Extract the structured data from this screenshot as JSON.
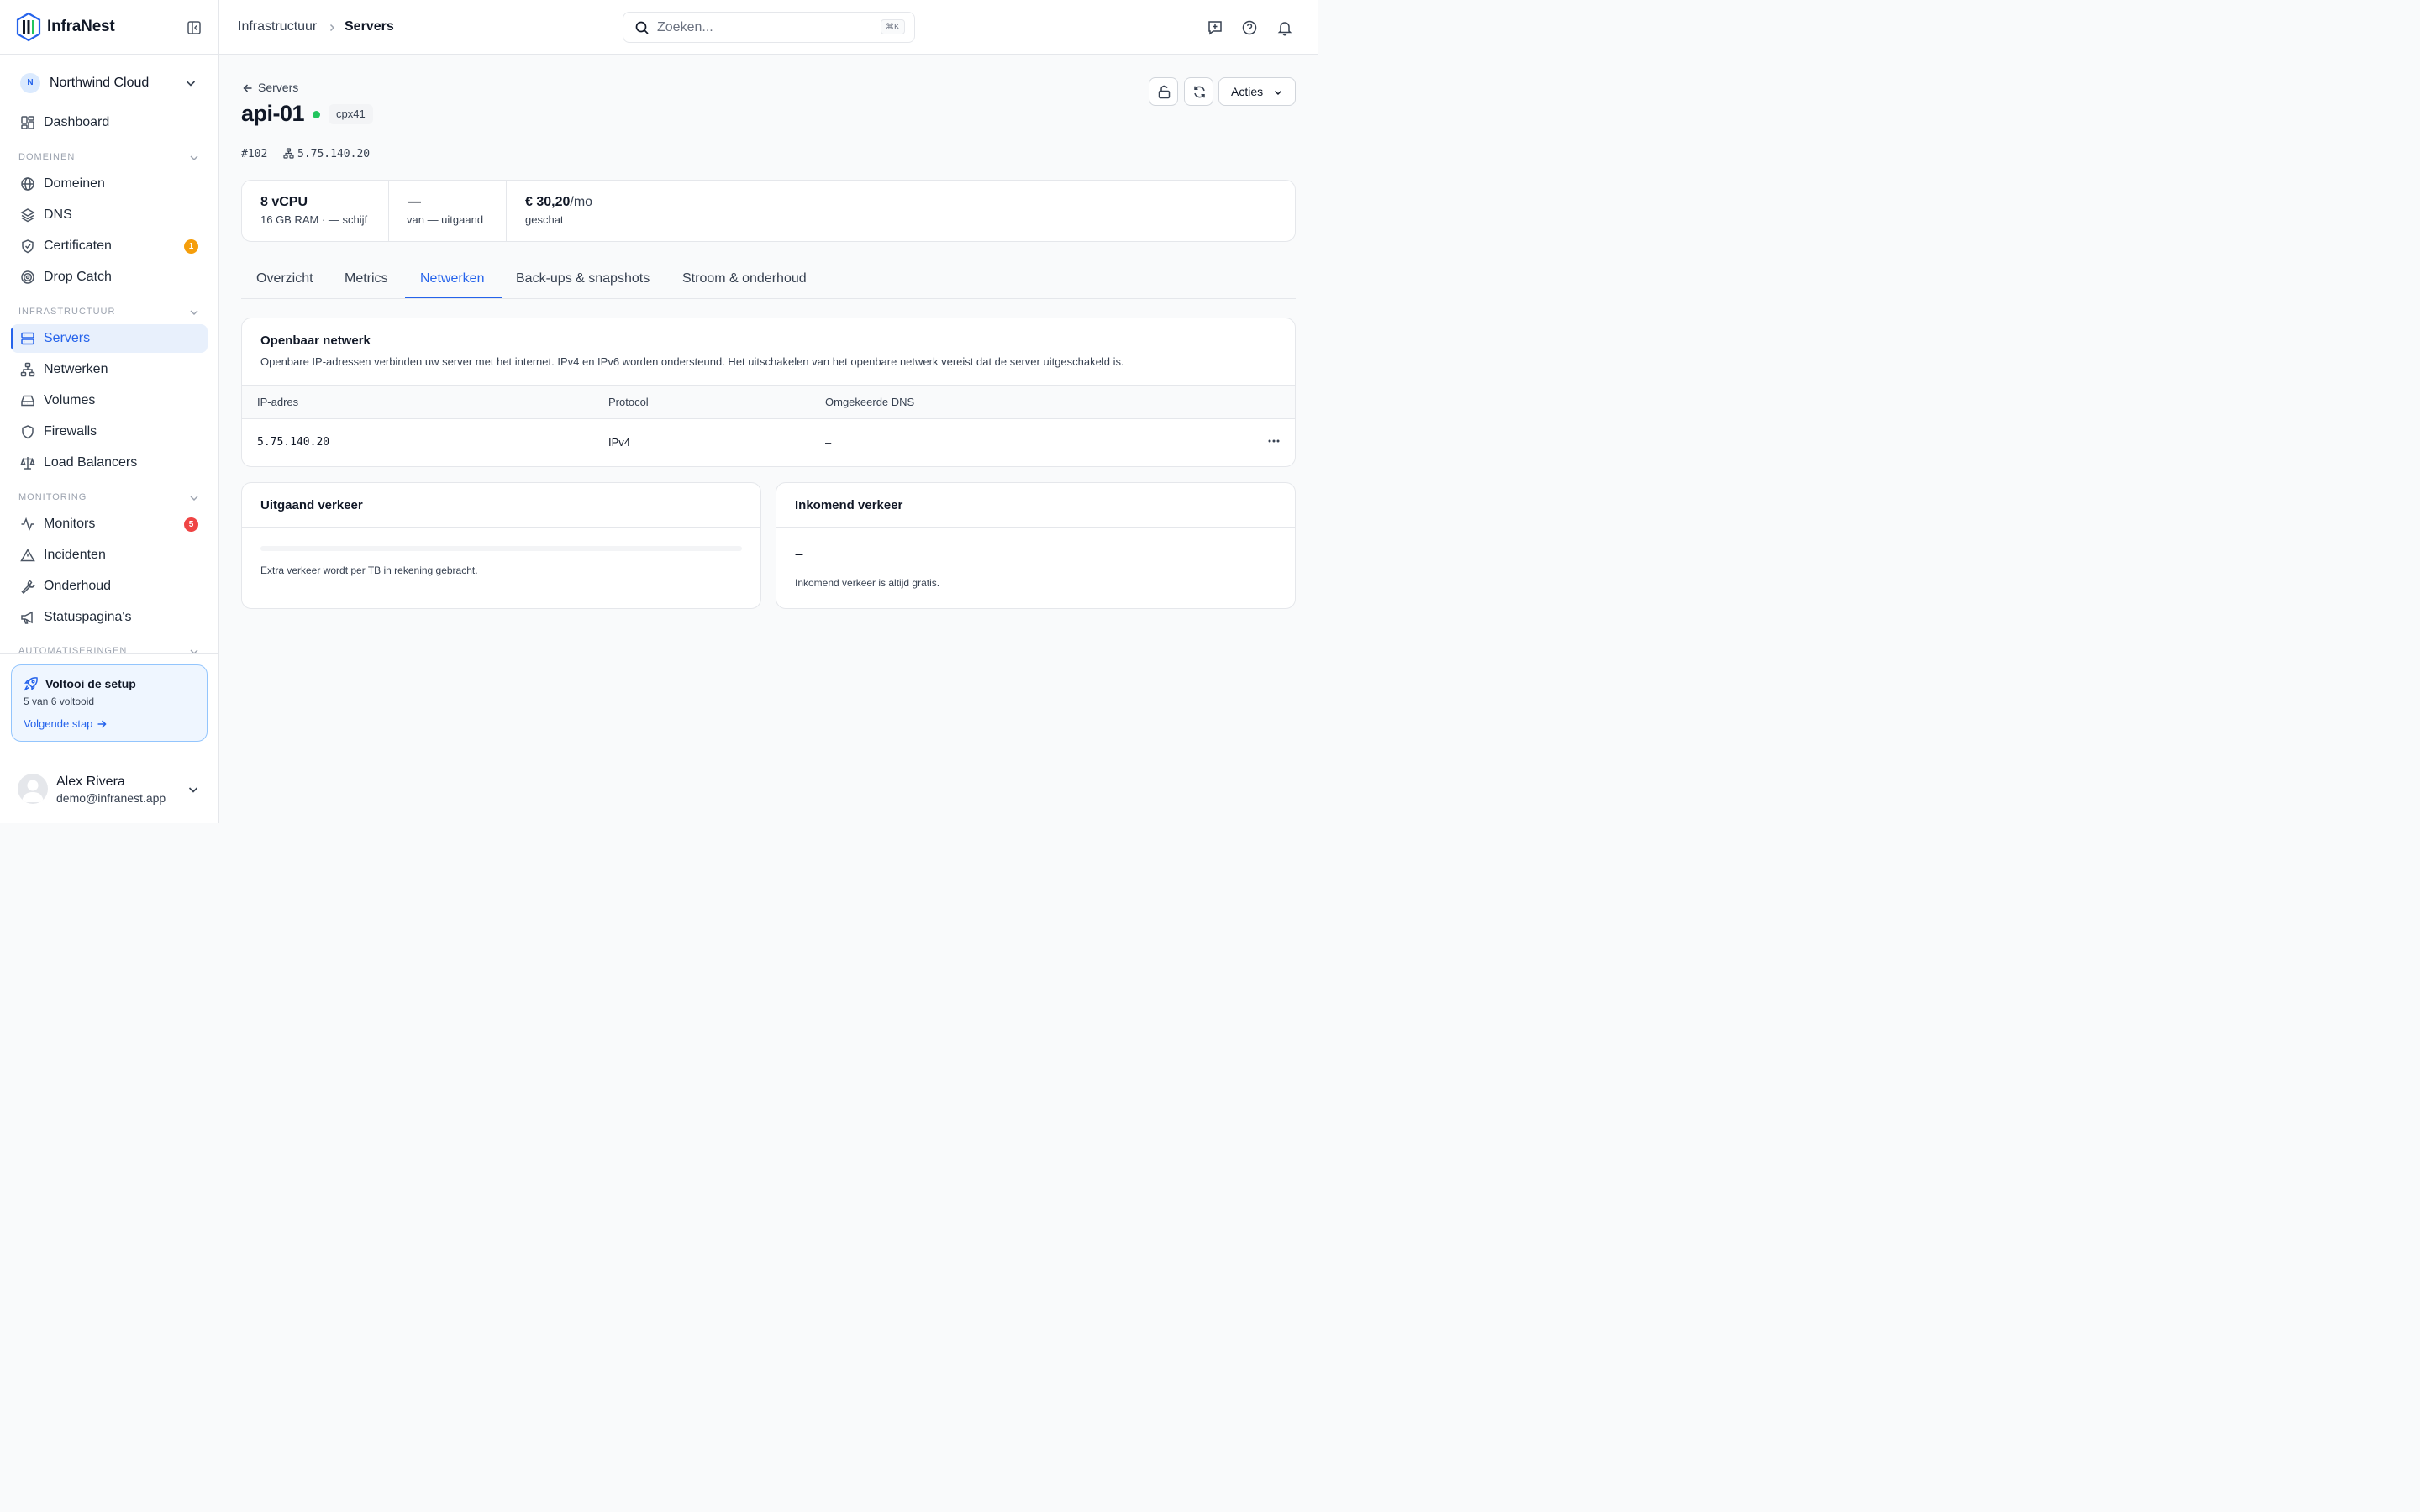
{
  "app": {
    "name": "InfraNest",
    "brand_color": "#2563eb"
  },
  "org": {
    "initial": "N",
    "name": "Northwind Cloud"
  },
  "nav": {
    "dashboard": "Dashboard",
    "sections": [
      {
        "title": "DOMEINEN",
        "items": [
          {
            "label": "Domeinen",
            "icon": "globe-icon"
          },
          {
            "label": "DNS",
            "icon": "layers-icon"
          },
          {
            "label": "Certificaten",
            "icon": "shield-check-icon",
            "badge": "1",
            "badge_color": "#f59e0b"
          },
          {
            "label": "Drop Catch",
            "icon": "target-icon"
          }
        ]
      },
      {
        "title": "INFRASTRUCTUUR",
        "items": [
          {
            "label": "Servers",
            "icon": "server-icon",
            "active": true
          },
          {
            "label": "Netwerken",
            "icon": "network-icon"
          },
          {
            "label": "Volumes",
            "icon": "hard-drive-icon"
          },
          {
            "label": "Firewalls",
            "icon": "shield-icon"
          },
          {
            "label": "Load Balancers",
            "icon": "scale-icon"
          }
        ]
      },
      {
        "title": "MONITORING",
        "items": [
          {
            "label": "Monitors",
            "icon": "activity-icon",
            "badge": "5",
            "badge_color": "#ef4444"
          },
          {
            "label": "Incidenten",
            "icon": "alert-triangle-icon"
          },
          {
            "label": "Onderhoud",
            "icon": "wrench-icon"
          },
          {
            "label": "Statuspagina's",
            "icon": "megaphone-icon"
          }
        ]
      },
      {
        "title": "AUTOMATISERINGEN",
        "items": []
      }
    ]
  },
  "setup": {
    "title": "Voltooi de setup",
    "progress": "5 van 6 voltooid",
    "link": "Volgende stap"
  },
  "user": {
    "name": "Alex Rivera",
    "email": "demo@infranest.app"
  },
  "topbar": {
    "breadcrumb": [
      "Infrastructuur",
      "Servers"
    ],
    "search_placeholder": "Zoeken...",
    "search_shortcut": "⌘K"
  },
  "server": {
    "back_label": "Servers",
    "name": "api-01",
    "status_color": "#22c55e",
    "type": "cpx41",
    "id": "#102",
    "ip": "5.75.140.20",
    "actions_label": "Acties"
  },
  "stats": [
    {
      "value": "8 vCPU",
      "unit": "",
      "sub": "16 GB RAM · — schijf"
    },
    {
      "value": "—",
      "unit": "",
      "sub": "van — uitgaand"
    },
    {
      "value": "€ 30,20",
      "unit": "/mo",
      "sub": "geschat"
    }
  ],
  "tabs": [
    "Overzicht",
    "Metrics",
    "Netwerken",
    "Back-ups & snapshots",
    "Stroom & onderhoud"
  ],
  "active_tab": "Netwerken",
  "public_network": {
    "title": "Openbaar netwerk",
    "description": "Openbare IP-adressen verbinden uw server met het internet. IPv4 en IPv6 worden ondersteund. Het uitschakelen van het openbare netwerk vereist dat de server uitgeschakeld is.",
    "columns": [
      "IP-adres",
      "Protocol",
      "Omgekeerde DNS"
    ],
    "rows": [
      {
        "ip": "5.75.140.20",
        "protocol": "IPv4",
        "rdns": "–"
      }
    ]
  },
  "outgoing": {
    "title": "Uitgaand verkeer",
    "usage_fraction": 0,
    "note": "Extra verkeer wordt per TB in rekening gebracht."
  },
  "incoming": {
    "title": "Inkomend verkeer",
    "value": "–",
    "note": "Inkomend verkeer is altijd gratis."
  }
}
